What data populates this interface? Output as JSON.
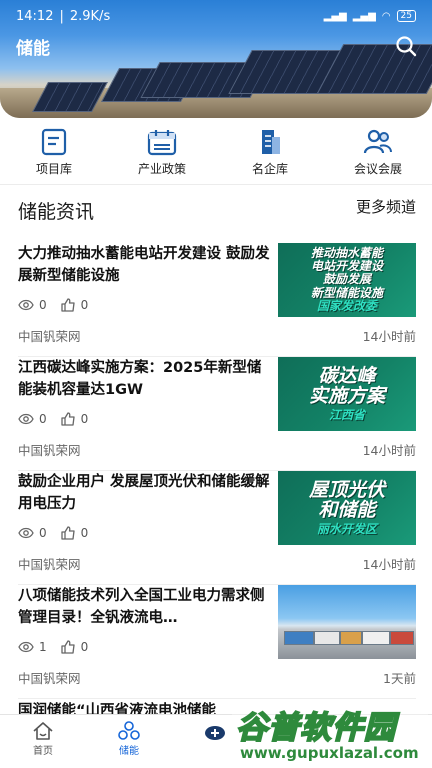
{
  "status_bar": {
    "time": "14:12",
    "net_speed": "2.9K/s",
    "battery": "25"
  },
  "header": {
    "title": "储能"
  },
  "quick_nav": [
    {
      "label": "项目库",
      "icon": "document-icon"
    },
    {
      "label": "产业政策",
      "icon": "calendar-icon"
    },
    {
      "label": "名企库",
      "icon": "building-icon"
    },
    {
      "label": "会议会展",
      "icon": "people-icon"
    }
  ],
  "section": {
    "title": "储能资讯",
    "more": "更多频道"
  },
  "news": [
    {
      "title": "大力推动抽水蓄能电站开发建设 鼓励发展新型储能设施",
      "views": "0",
      "likes": "0",
      "source": "中国钒荣网",
      "time": "14小时前",
      "thumb": {
        "lines": [
          "推动抽水蓄能",
          "电站开发建设",
          "鼓励发展",
          "新型储能设施"
        ],
        "sub": "国家发改委"
      }
    },
    {
      "title": "江西碳达峰实施方案：2025年新型储能装机容量达1GW",
      "views": "0",
      "likes": "0",
      "source": "中国钒荣网",
      "time": "14小时前",
      "thumb": {
        "lines": [
          "碳达峰",
          "实施方案"
        ],
        "sub": "江西省"
      }
    },
    {
      "title": "鼓励企业用户 发展屋顶光伏和储能缓解用电压力",
      "views": "0",
      "likes": "0",
      "source": "中国钒荣网",
      "time": "14小时前",
      "thumb": {
        "lines": [
          "屋顶光伏",
          "和储能"
        ],
        "sub": "丽水开发区"
      }
    },
    {
      "title": "八项储能技术列入全国工业电力需求侧管理目录！全钒液流电…",
      "views": "1",
      "likes": "0",
      "source": "中国钒荣网",
      "time": "1天前"
    }
  ],
  "partial_news_title": "国润储能“山西省液流电池储能",
  "bottom_nav": [
    {
      "label": "首页",
      "icon": "home-icon"
    },
    {
      "label": "储能",
      "icon": "energy-storage-icon",
      "active": true
    },
    {
      "label": "",
      "icon": "plus-icon"
    }
  ],
  "watermark": {
    "text": "谷普软件园",
    "url": "www.gupuxlazal.com"
  },
  "colors": {
    "accent": "#1565d8",
    "icon_blue": "#1f5fa8",
    "thumb_green": "#138266"
  }
}
